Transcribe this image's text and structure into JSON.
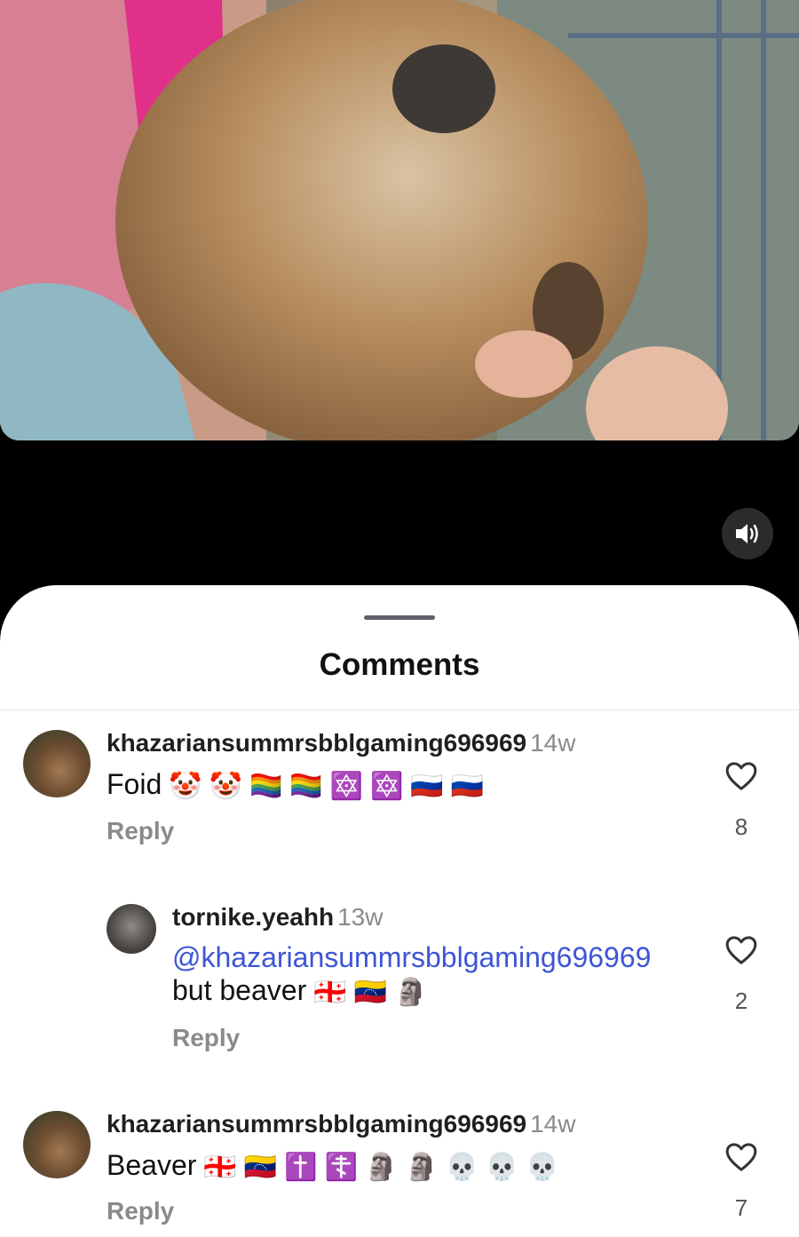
{
  "video": {
    "description_icon": "video-frame",
    "mute_icon": "speaker-icon"
  },
  "sheet": {
    "title": "Comments"
  },
  "comments": [
    {
      "username": "khazariansummrsbblgaming696969",
      "time": "14w",
      "text": "Foid",
      "emojis": [
        "🤡",
        "🤡",
        "🏳️‍🌈",
        "🏳️‍🌈",
        "🔯",
        "🔯",
        "🇷🇺",
        "🇷🇺"
      ],
      "reply_label": "Reply",
      "likes": "8"
    },
    {
      "username": "tornike.yeahh",
      "time": "13w",
      "mention": "@khazariansummrsbblgaming696969",
      "text": "but beaver",
      "emojis": [
        "🇬🇪",
        "🇻🇪",
        "🗿"
      ],
      "reply_label": "Reply",
      "likes": "2"
    },
    {
      "username": "khazariansummrsbblgaming696969",
      "time": "14w",
      "text": "Beaver",
      "emojis": [
        "🇬🇪",
        "🇻🇪",
        "✝️",
        "☦️",
        "🗿",
        "🗿",
        "💀",
        "💀",
        "💀"
      ],
      "reply_label": "Reply",
      "likes": "7"
    }
  ],
  "colors": {
    "mention": "#3e55d6",
    "muted_text": "#8a8a8a",
    "sheet_bg": "#ffffff"
  }
}
